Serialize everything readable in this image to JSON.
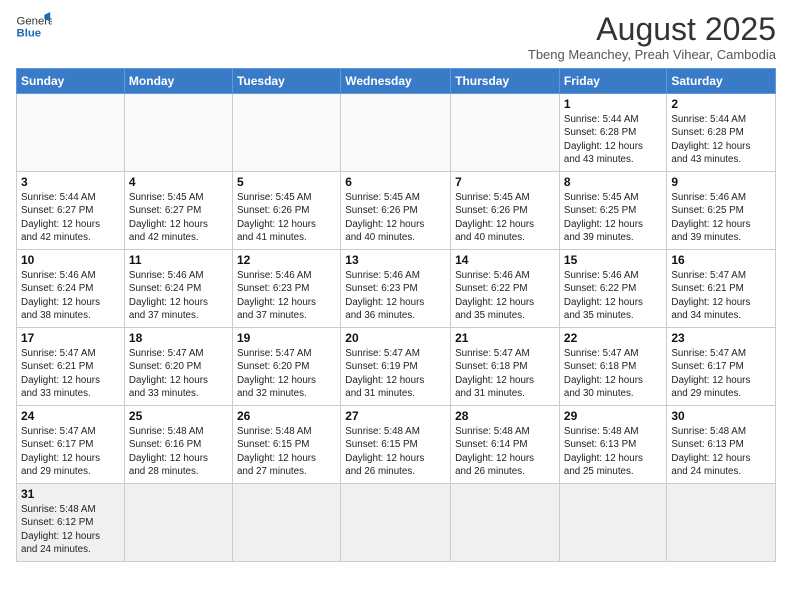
{
  "header": {
    "logo_text_regular": "General",
    "logo_text_bold": "Blue",
    "month_title": "August 2025",
    "subtitle": "Tbeng Meanchey, Preah Vihear, Cambodia"
  },
  "days_of_week": [
    "Sunday",
    "Monday",
    "Tuesday",
    "Wednesday",
    "Thursday",
    "Friday",
    "Saturday"
  ],
  "weeks": [
    [
      {
        "day": "",
        "info": ""
      },
      {
        "day": "",
        "info": ""
      },
      {
        "day": "",
        "info": ""
      },
      {
        "day": "",
        "info": ""
      },
      {
        "day": "",
        "info": ""
      },
      {
        "day": "1",
        "info": "Sunrise: 5:44 AM\nSunset: 6:28 PM\nDaylight: 12 hours\nand 43 minutes."
      },
      {
        "day": "2",
        "info": "Sunrise: 5:44 AM\nSunset: 6:28 PM\nDaylight: 12 hours\nand 43 minutes."
      }
    ],
    [
      {
        "day": "3",
        "info": "Sunrise: 5:44 AM\nSunset: 6:27 PM\nDaylight: 12 hours\nand 42 minutes."
      },
      {
        "day": "4",
        "info": "Sunrise: 5:45 AM\nSunset: 6:27 PM\nDaylight: 12 hours\nand 42 minutes."
      },
      {
        "day": "5",
        "info": "Sunrise: 5:45 AM\nSunset: 6:26 PM\nDaylight: 12 hours\nand 41 minutes."
      },
      {
        "day": "6",
        "info": "Sunrise: 5:45 AM\nSunset: 6:26 PM\nDaylight: 12 hours\nand 40 minutes."
      },
      {
        "day": "7",
        "info": "Sunrise: 5:45 AM\nSunset: 6:26 PM\nDaylight: 12 hours\nand 40 minutes."
      },
      {
        "day": "8",
        "info": "Sunrise: 5:45 AM\nSunset: 6:25 PM\nDaylight: 12 hours\nand 39 minutes."
      },
      {
        "day": "9",
        "info": "Sunrise: 5:46 AM\nSunset: 6:25 PM\nDaylight: 12 hours\nand 39 minutes."
      }
    ],
    [
      {
        "day": "10",
        "info": "Sunrise: 5:46 AM\nSunset: 6:24 PM\nDaylight: 12 hours\nand 38 minutes."
      },
      {
        "day": "11",
        "info": "Sunrise: 5:46 AM\nSunset: 6:24 PM\nDaylight: 12 hours\nand 37 minutes."
      },
      {
        "day": "12",
        "info": "Sunrise: 5:46 AM\nSunset: 6:23 PM\nDaylight: 12 hours\nand 37 minutes."
      },
      {
        "day": "13",
        "info": "Sunrise: 5:46 AM\nSunset: 6:23 PM\nDaylight: 12 hours\nand 36 minutes."
      },
      {
        "day": "14",
        "info": "Sunrise: 5:46 AM\nSunset: 6:22 PM\nDaylight: 12 hours\nand 35 minutes."
      },
      {
        "day": "15",
        "info": "Sunrise: 5:46 AM\nSunset: 6:22 PM\nDaylight: 12 hours\nand 35 minutes."
      },
      {
        "day": "16",
        "info": "Sunrise: 5:47 AM\nSunset: 6:21 PM\nDaylight: 12 hours\nand 34 minutes."
      }
    ],
    [
      {
        "day": "17",
        "info": "Sunrise: 5:47 AM\nSunset: 6:21 PM\nDaylight: 12 hours\nand 33 minutes."
      },
      {
        "day": "18",
        "info": "Sunrise: 5:47 AM\nSunset: 6:20 PM\nDaylight: 12 hours\nand 33 minutes."
      },
      {
        "day": "19",
        "info": "Sunrise: 5:47 AM\nSunset: 6:20 PM\nDaylight: 12 hours\nand 32 minutes."
      },
      {
        "day": "20",
        "info": "Sunrise: 5:47 AM\nSunset: 6:19 PM\nDaylight: 12 hours\nand 31 minutes."
      },
      {
        "day": "21",
        "info": "Sunrise: 5:47 AM\nSunset: 6:18 PM\nDaylight: 12 hours\nand 31 minutes."
      },
      {
        "day": "22",
        "info": "Sunrise: 5:47 AM\nSunset: 6:18 PM\nDaylight: 12 hours\nand 30 minutes."
      },
      {
        "day": "23",
        "info": "Sunrise: 5:47 AM\nSunset: 6:17 PM\nDaylight: 12 hours\nand 29 minutes."
      }
    ],
    [
      {
        "day": "24",
        "info": "Sunrise: 5:47 AM\nSunset: 6:17 PM\nDaylight: 12 hours\nand 29 minutes."
      },
      {
        "day": "25",
        "info": "Sunrise: 5:48 AM\nSunset: 6:16 PM\nDaylight: 12 hours\nand 28 minutes."
      },
      {
        "day": "26",
        "info": "Sunrise: 5:48 AM\nSunset: 6:15 PM\nDaylight: 12 hours\nand 27 minutes."
      },
      {
        "day": "27",
        "info": "Sunrise: 5:48 AM\nSunset: 6:15 PM\nDaylight: 12 hours\nand 26 minutes."
      },
      {
        "day": "28",
        "info": "Sunrise: 5:48 AM\nSunset: 6:14 PM\nDaylight: 12 hours\nand 26 minutes."
      },
      {
        "day": "29",
        "info": "Sunrise: 5:48 AM\nSunset: 6:13 PM\nDaylight: 12 hours\nand 25 minutes."
      },
      {
        "day": "30",
        "info": "Sunrise: 5:48 AM\nSunset: 6:13 PM\nDaylight: 12 hours\nand 24 minutes."
      }
    ],
    [
      {
        "day": "31",
        "info": "Sunrise: 5:48 AM\nSunset: 6:12 PM\nDaylight: 12 hours\nand 24 minutes."
      },
      {
        "day": "",
        "info": ""
      },
      {
        "day": "",
        "info": ""
      },
      {
        "day": "",
        "info": ""
      },
      {
        "day": "",
        "info": ""
      },
      {
        "day": "",
        "info": ""
      },
      {
        "day": "",
        "info": ""
      }
    ]
  ]
}
